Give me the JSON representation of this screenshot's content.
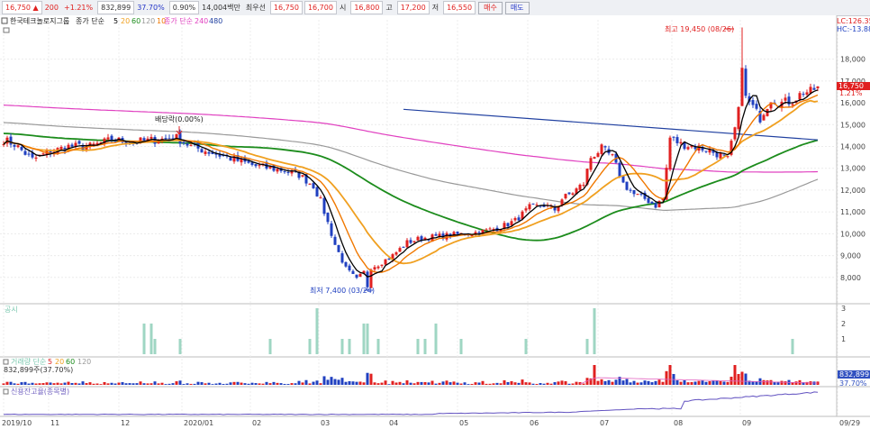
{
  "toolbar": {
    "price": "16,750",
    "arrow": "▲",
    "change": "200",
    "change_pct": "+1.21%",
    "volume": "832,899",
    "vol_ratio": "37.70%",
    "turnover": "0.90%",
    "amount": "14,004백만",
    "best_ask_label": "최우선",
    "best_ask": "16,750",
    "best_bid": "16,700",
    "open_label": "시",
    "open": "16,800",
    "high_label": "고",
    "high": "17,200",
    "low_label": "저",
    "low": "16,550",
    "buy": "매수",
    "sell": "매도"
  },
  "legend": {
    "stock": "한국테크놀로지그룹",
    "ma_label": "종가 단순",
    "ma": [
      {
        "text": "5",
        "color": "#000000"
      },
      {
        "text": "20",
        "color": "#f0a020"
      },
      {
        "text": "60",
        "color": "#1c8c1c"
      },
      {
        "text": "120",
        "color": "#999999"
      },
      {
        "text": "10",
        "color": "#f07800"
      }
    ],
    "ma2_label": "종가 단순",
    "ma2": [
      {
        "text": "240",
        "color": "#e040c0"
      },
      {
        "text": "480",
        "color": "#2040a0"
      }
    ]
  },
  "labels": {
    "lc": "LC:126.35",
    "hc": "HC:-13.88",
    "high_annot": "최고 19,450 (08/26)",
    "low_annot": "최저 7,400 (03/24)",
    "dividend": "배당락(0.00%)",
    "cur_price": "16,750",
    "cur_pct": "1.21%",
    "disclosure": "공시",
    "vol_title": "거래량 단순",
    "vol_ma": [
      "5",
      "20",
      "60",
      "120"
    ],
    "vol_value": "832,899주(37.70%)",
    "vol_box": "832,899",
    "vol_pct": "37.70%",
    "credit": "신용잔고율(종목별)"
  },
  "chart_data": [
    {
      "type": "candlestick",
      "title": "한국테크놀로지그룹",
      "y_ticks": [
        8000,
        9000,
        10000,
        11000,
        12000,
        13000,
        14000,
        15000,
        16000,
        17000,
        18000
      ],
      "ylim": [
        7000,
        19800
      ],
      "x_ticks": [
        "2019/10",
        "11",
        "12",
        "2020/01",
        "02",
        "03",
        "04",
        "05",
        "06",
        "07",
        "08",
        "09",
        "09/29"
      ],
      "x_tick_index": [
        0,
        12.5,
        32,
        49.5,
        68.5,
        87.5,
        106.5,
        126,
        145.5,
        165,
        185.5,
        204.5,
        226
      ],
      "n_bars": 227,
      "anchors": [
        [
          0,
          14300
        ],
        [
          3,
          14100
        ],
        [
          8,
          13400
        ],
        [
          12,
          13700
        ],
        [
          18,
          14000
        ],
        [
          24,
          14000
        ],
        [
          30,
          14300
        ],
        [
          36,
          14200
        ],
        [
          42,
          14300
        ],
        [
          48,
          14400
        ],
        [
          52,
          14000
        ],
        [
          58,
          13700
        ],
        [
          62,
          13500
        ],
        [
          66,
          13300
        ],
        [
          70,
          13100
        ],
        [
          74,
          13000
        ],
        [
          78,
          12900
        ],
        [
          82,
          12700
        ],
        [
          86,
          12200
        ],
        [
          88,
          11500
        ],
        [
          90,
          10500
        ],
        [
          92,
          9500
        ],
        [
          95,
          8400
        ],
        [
          98,
          7900
        ],
        [
          101,
          8400
        ],
        [
          104,
          8600
        ],
        [
          108,
          9000
        ],
        [
          112,
          9600
        ],
        [
          116,
          9800
        ],
        [
          122,
          9900
        ],
        [
          128,
          10000
        ],
        [
          133,
          10100
        ],
        [
          138,
          10300
        ],
        [
          142,
          10600
        ],
        [
          146,
          11200
        ],
        [
          150,
          11300
        ],
        [
          153,
          11100
        ],
        [
          155,
          11600
        ],
        [
          158,
          11900
        ],
        [
          161,
          12300
        ],
        [
          163,
          13500
        ],
        [
          166,
          13900
        ],
        [
          169,
          13500
        ],
        [
          172,
          12300
        ],
        [
          175,
          11800
        ],
        [
          178,
          11600
        ],
        [
          181,
          11300
        ],
        [
          183,
          11600
        ],
        [
          185,
          14400
        ],
        [
          188,
          14100
        ],
        [
          192,
          14000
        ],
        [
          196,
          13800
        ],
        [
          199,
          13600
        ],
        [
          201,
          13400
        ],
        [
          203,
          14800
        ],
        [
          205,
          16400
        ],
        [
          208,
          15800
        ],
        [
          210,
          15300
        ],
        [
          213,
          16200
        ],
        [
          216,
          16000
        ],
        [
          219,
          16100
        ],
        [
          222,
          16500
        ],
        [
          224,
          16500
        ],
        [
          226,
          16750
        ]
      ],
      "high": {
        "value": 19450,
        "date": "08/26",
        "index": 205
      },
      "low": {
        "value": 7400,
        "date": "03/24",
        "index": 101
      },
      "last": 16750,
      "trendline": {
        "from": [
          111,
          15700
        ],
        "to": [
          226,
          14300
        ]
      }
    },
    {
      "type": "bar",
      "title": "공시",
      "ylim": [
        0,
        3
      ],
      "y_ticks": [
        1,
        2,
        3
      ],
      "bars": [
        [
          39,
          2
        ],
        [
          41,
          2
        ],
        [
          42,
          1
        ],
        [
          49,
          1
        ],
        [
          74,
          1
        ],
        [
          85,
          1
        ],
        [
          87,
          3
        ],
        [
          94,
          1
        ],
        [
          96,
          1
        ],
        [
          100,
          2
        ],
        [
          101,
          2
        ],
        [
          104,
          1
        ],
        [
          115,
          1
        ],
        [
          117,
          1
        ],
        [
          120,
          2
        ],
        [
          127,
          1
        ],
        [
          145,
          1
        ],
        [
          162,
          1
        ],
        [
          164,
          3
        ],
        [
          219,
          1
        ]
      ]
    },
    {
      "type": "bar",
      "title": "거래량 단순",
      "value": "832,899"
    },
    {
      "type": "line",
      "title": "신용잔고율(종목별)"
    }
  ]
}
